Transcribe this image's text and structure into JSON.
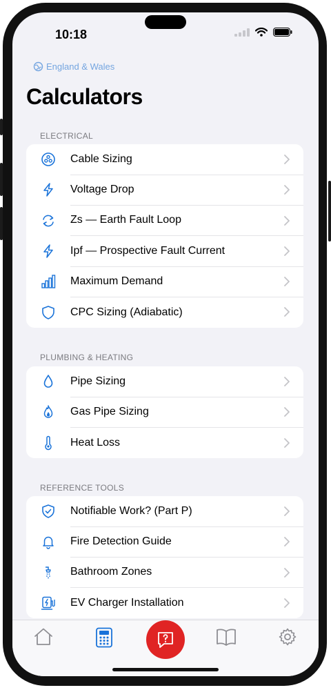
{
  "status_bar": {
    "time": "10:18"
  },
  "header": {
    "region": "England & Wales",
    "title": "Calculators"
  },
  "colors": {
    "accent": "#1a73d9",
    "fab": "#e02424",
    "background": "#f2f2f7"
  },
  "sections": [
    {
      "title": "ELECTRICAL",
      "items": [
        {
          "label": "Cable Sizing",
          "icon": "cable-icon"
        },
        {
          "label": "Voltage Drop",
          "icon": "lightning-icon"
        },
        {
          "label": "Zs — Earth Fault Loop",
          "icon": "loop-icon"
        },
        {
          "label": "Ipf — Prospective Fault Current",
          "icon": "lightning-icon"
        },
        {
          "label": "Maximum Demand",
          "icon": "bar-chart-icon"
        },
        {
          "label": "CPC Sizing (Adiabatic)",
          "icon": "shield-icon"
        }
      ]
    },
    {
      "title": "PLUMBING & HEATING",
      "items": [
        {
          "label": "Pipe Sizing",
          "icon": "droplet-icon"
        },
        {
          "label": "Gas Pipe Sizing",
          "icon": "flame-icon"
        },
        {
          "label": "Heat Loss",
          "icon": "thermometer-icon"
        }
      ]
    },
    {
      "title": "REFERENCE TOOLS",
      "items": [
        {
          "label": "Notifiable Work? (Part P)",
          "icon": "shield-check-icon"
        },
        {
          "label": "Fire Detection Guide",
          "icon": "bell-icon"
        },
        {
          "label": "Bathroom Zones",
          "icon": "shower-icon"
        },
        {
          "label": "EV Charger Installation",
          "icon": "ev-charger-icon"
        }
      ]
    }
  ],
  "tabbar": {
    "tabs": [
      {
        "icon": "home-icon",
        "active": false
      },
      {
        "icon": "calculator-icon",
        "active": true
      },
      {
        "icon": "help-chat-icon",
        "active": false
      },
      {
        "icon": "book-icon",
        "active": false
      },
      {
        "icon": "gear-icon",
        "active": false
      }
    ]
  }
}
